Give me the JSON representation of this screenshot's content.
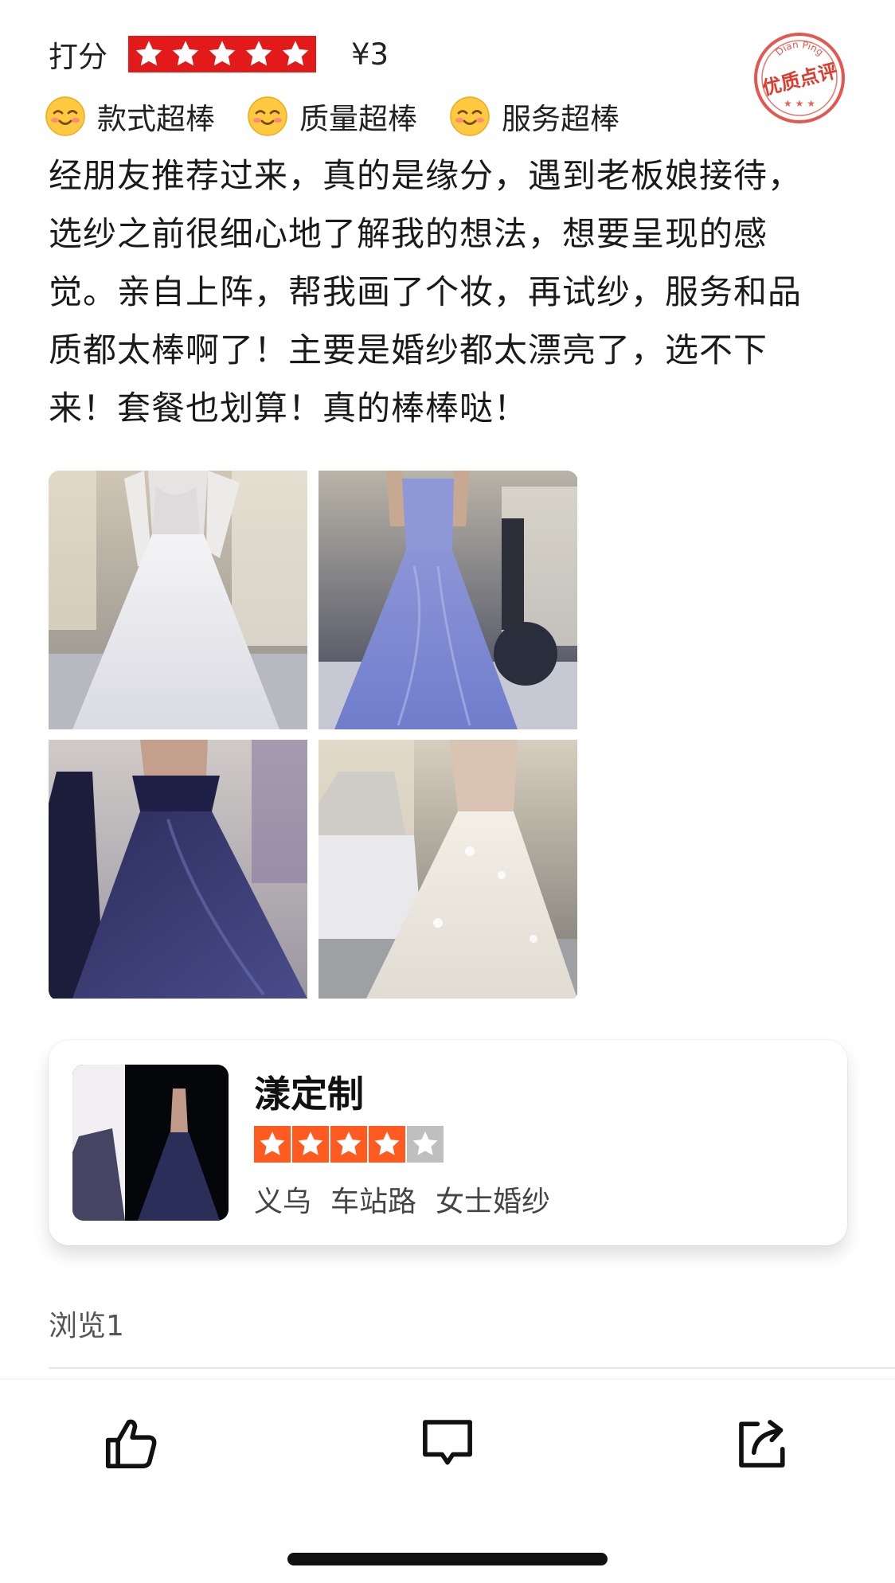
{
  "rating": {
    "label": "打分",
    "stars": 5,
    "price": "¥3"
  },
  "stamp": {
    "top_text": "Dian Ping",
    "main_text": "优质点评",
    "color": "#e03a2f"
  },
  "tags": [
    {
      "icon": "smile-emoji-icon",
      "label": "款式超棒"
    },
    {
      "icon": "smile-emoji-icon",
      "label": "质量超棒"
    },
    {
      "icon": "smile-emoji-icon",
      "label": "服务超棒"
    }
  ],
  "review": {
    "lines": [
      "经朋友推荐过来，真的是缘分，遇到老板娘接待，",
      "选纱之前很细心地了解我的想法，想要呈现的感",
      "觉。亲自上阵，帮我画了个妆，再试纱，服务和品",
      "质都太棒啊了！主要是婚纱都太漂亮了，选不下",
      "来！套餐也划算！真的棒棒哒！"
    ]
  },
  "photos": [
    {
      "name": "white-lace-gown-photo"
    },
    {
      "name": "lavender-gown-photo"
    },
    {
      "name": "navy-offshoulder-gown-photo"
    },
    {
      "name": "ivory-tulle-gown-photo"
    }
  ],
  "shop": {
    "name": "漾定制",
    "stars": 4,
    "max_stars": 5,
    "meta": [
      "义乌",
      "车站路",
      "女士婚纱"
    ],
    "star_color": "#ff5a1f"
  },
  "views": "浏览1",
  "actions": [
    {
      "name": "like-button",
      "icon": "thumbs-up-icon"
    },
    {
      "name": "comment-button",
      "icon": "comment-icon"
    },
    {
      "name": "share-button",
      "icon": "share-icon"
    }
  ],
  "colors": {
    "rating_red": "#e21a1a",
    "shop_orange": "#ff5a1f",
    "stamp_red": "#e03a2f"
  }
}
